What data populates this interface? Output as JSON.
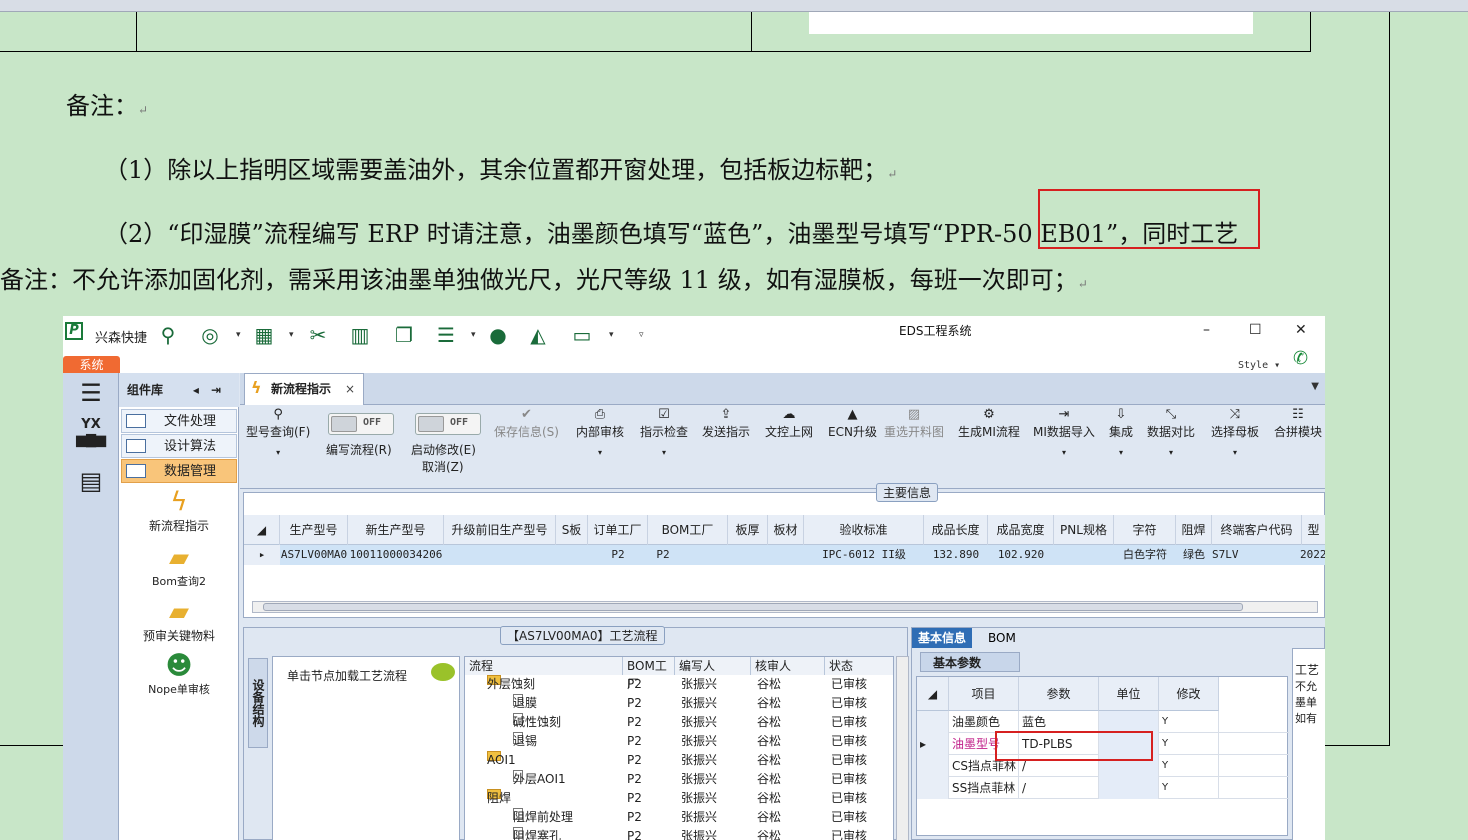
{
  "document": {
    "note_title": "备注：",
    "para1": "（1）除以上指明区域需要盖油外，其余位置都开窗处理，包括板边标靶；",
    "para2_part1": "（2）“印湿膜”流程编写 ERP 时请注意，油墨颜色填写“蓝色”，油墨型号填写",
    "para2_highlight": "“PPR-50 EB01”",
    "para2_part2": "，同时工艺",
    "para3": "备注：不允许添加固化剂，需采用该油墨单独做光尺，光尺等级 11 级，如有湿膜板，每班一次即可；",
    "para_mark": "↵"
  },
  "app": {
    "quick_access_label": "兴森快捷",
    "window_title": "EDS工程系统",
    "win_min": "–",
    "win_max": "☐",
    "win_close": "✕",
    "style_label": "Style ▾",
    "system_tab": "系统"
  },
  "component_panel": {
    "title": "组件库",
    "items": [
      "文件处理",
      "设计算法",
      "数据管理"
    ],
    "tools": [
      "新流程指示",
      "Bom查询2",
      "预审关键物料",
      "Nope单审核"
    ]
  },
  "doc_tab": {
    "label": "新流程指示",
    "close": "×"
  },
  "ribbon": {
    "buttons": [
      {
        "label": "型号查询(F)"
      },
      {
        "label": "保存信息(S)"
      },
      {
        "label": "内部审核"
      },
      {
        "label": "指示检查"
      },
      {
        "label": "发送指示"
      },
      {
        "label": "文控上网"
      },
      {
        "label": "ECN升级"
      },
      {
        "label": "重选开料图"
      },
      {
        "label": "生成MI流程"
      },
      {
        "label": "MI数据导入"
      },
      {
        "label": "集成"
      },
      {
        "label": "数据对比"
      },
      {
        "label": "选择母板"
      },
      {
        "label": "合拼模块"
      }
    ],
    "toggle1": {
      "state": "OFF",
      "label": "编写流程(R)"
    },
    "toggle2": {
      "state": "OFF",
      "label": "启动修改(E)",
      "label2": "取消(Z)"
    }
  },
  "main_info": {
    "caption": "主要信息",
    "columns": [
      "生产型号",
      "新生产型号",
      "升级前旧生产型号",
      "S板",
      "订单工厂",
      "BOM工厂",
      "板厚",
      "板材",
      "验收标准",
      "成品长度",
      "成品宽度",
      "PNL规格",
      "字符",
      "阻焊",
      "终端客户代码",
      "型"
    ],
    "row": [
      "AS7LV00MA0",
      "10011000034206",
      "",
      "",
      "P2",
      "P2",
      "",
      "",
      "IPC-6012 II级",
      "132.890",
      "102.920",
      "",
      "白色字符",
      "绿色",
      "S7LV",
      "2022"
    ]
  },
  "process": {
    "caption": "【AS7LV00MA0】工艺流程",
    "vertical_tab": "设备结构",
    "hint": "单击节点加载工艺流程",
    "columns": [
      "流程",
      "BOM工厂",
      "编写人",
      "核审人",
      "状态"
    ],
    "rows": [
      {
        "name": "外层蚀刻",
        "folder": true,
        "bom": "P2",
        "writer": "张振兴",
        "reviewer": "谷松",
        "status": "已审核"
      },
      {
        "name": "退膜",
        "folder": false,
        "bom": "P2",
        "writer": "张振兴",
        "reviewer": "谷松",
        "status": "已审核"
      },
      {
        "name": "碱性蚀刻",
        "folder": false,
        "bom": "P2",
        "writer": "张振兴",
        "reviewer": "谷松",
        "status": "已审核"
      },
      {
        "name": "退锡",
        "folder": false,
        "bom": "P2",
        "writer": "张振兴",
        "reviewer": "谷松",
        "status": "已审核"
      },
      {
        "name": "AOI1",
        "folder": true,
        "bom": "P2",
        "writer": "张振兴",
        "reviewer": "谷松",
        "status": "已审核"
      },
      {
        "name": "外层AOI1",
        "folder": false,
        "bom": "P2",
        "writer": "张振兴",
        "reviewer": "谷松",
        "status": "已审核"
      },
      {
        "name": "阻焊",
        "folder": true,
        "bom": "P2",
        "writer": "张振兴",
        "reviewer": "谷松",
        "status": "已审核"
      },
      {
        "name": "阻焊前处理",
        "folder": false,
        "bom": "P2",
        "writer": "张振兴",
        "reviewer": "谷松",
        "status": "已审核"
      },
      {
        "name": "阻焊塞孔",
        "folder": false,
        "bom": "P2",
        "writer": "张振兴",
        "reviewer": "谷松",
        "status": "已审核"
      }
    ]
  },
  "info": {
    "tab_basic": "基本信息",
    "tab_bom": "BOM",
    "param_title": "基本参数",
    "columns": [
      "项目",
      "参数",
      "单位",
      "修改"
    ],
    "rows": [
      {
        "item": "油墨颜色",
        "value": "蓝色",
        "unit": "",
        "mod": "Y"
      },
      {
        "item": "油墨型号",
        "value": "TD-PLBS",
        "unit": "",
        "mod": "Y"
      },
      {
        "item": "CS挡点菲林",
        "value": "/",
        "unit": "",
        "mod": "Y"
      },
      {
        "item": "SS挡点菲林",
        "value": "/",
        "unit": "",
        "mod": "Y"
      }
    ],
    "side_label": "工艺",
    "side_text": "不允墨单如有"
  }
}
